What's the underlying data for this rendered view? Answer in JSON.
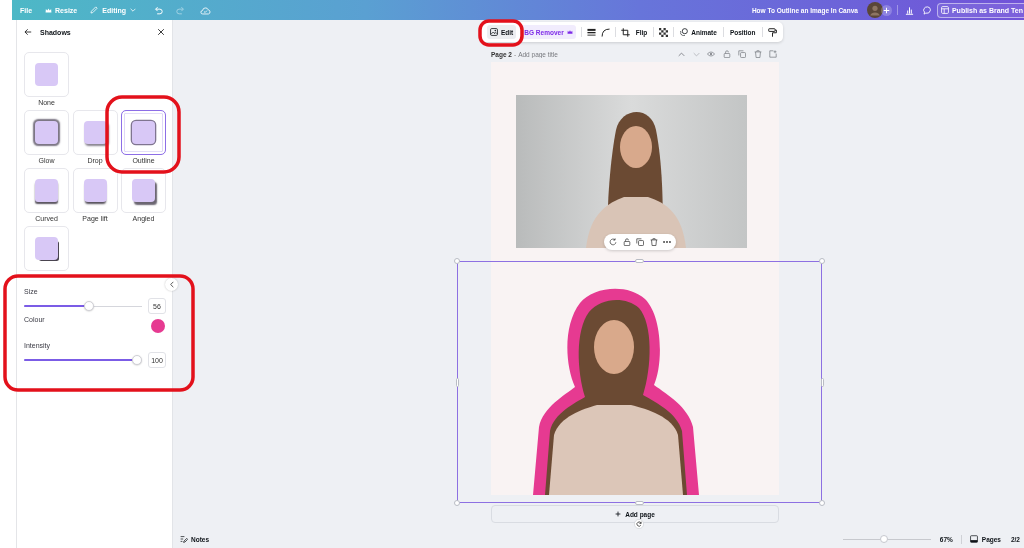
{
  "top_bar": {
    "menu": [
      {
        "label": "File",
        "kind": "plain"
      },
      {
        "label": "Resize",
        "kind": "premium"
      },
      {
        "label": "Editing",
        "kind": "mode"
      }
    ],
    "undo": {
      "disabled": false
    },
    "redo": {
      "disabled": true
    },
    "document_title": "How To Outline an Image In Canva",
    "publish_button": "Publish as Brand Ten"
  },
  "shadows_panel": {
    "title": "Shadows",
    "effects": [
      {
        "label": "None",
        "kind": "none",
        "selected": false
      },
      {
        "label": "Glow",
        "kind": "glow",
        "selected": false
      },
      {
        "label": "Drop",
        "kind": "drop",
        "selected": false
      },
      {
        "label": "Outline",
        "kind": "outline",
        "selected": true
      },
      {
        "label": "Curved",
        "kind": "curved",
        "selected": false
      },
      {
        "label": "Page lift",
        "kind": "lift",
        "selected": false
      },
      {
        "label": "Angled",
        "kind": "angled",
        "selected": false
      },
      {
        "kind": "corner",
        "selected": false
      }
    ],
    "settings": [
      {
        "kind": "slider",
        "label": "Size",
        "level": 0.56,
        "value": "56"
      },
      {
        "kind": "color",
        "label": "Colour",
        "color": "#e63a91"
      },
      {
        "kind": "slider",
        "label": "Intensity",
        "level": 1,
        "value": "100"
      }
    ]
  },
  "element_toolbar": {
    "edit": "Edit",
    "bg_remover": "BG Remover",
    "flip": "Flip",
    "animate": "Animate",
    "position": "Position"
  },
  "page_header": {
    "page": "Page 2",
    "separator": "-",
    "title": {
      "placeholder": "Add page title"
    }
  },
  "add_page": "Add page",
  "footer": {
    "notes": "Notes",
    "zoom": {
      "level": 0.47,
      "reading": "67%"
    },
    "pages": "Pages",
    "page_count": "2/2"
  }
}
